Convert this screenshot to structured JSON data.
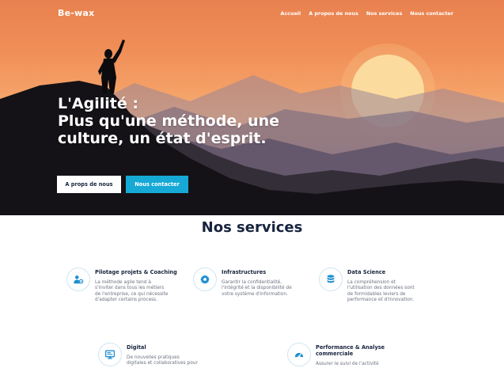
{
  "nav": {
    "brand": "Be-wax",
    "links": [
      "Accueil",
      "A propos de nous",
      "Nos services",
      "Nous contacter"
    ]
  },
  "hero": {
    "title_lines": [
      "L'Agilité :",
      "Plus qu'une méthode, une",
      "culture, un état d'esprit."
    ],
    "buttons": {
      "about": "A props de nous",
      "contact": "Nous contacter"
    }
  },
  "services": {
    "title": "Nos services",
    "items": [
      {
        "icon": "user-cog-icon",
        "title_lines": [
          "Pilotage projets & Coaching"
        ],
        "desc_lines": [
          "La méthode agile tend à",
          "s'inviter dans tous les métiers",
          "de l'entreprise, ce qui nécessite",
          "d'adapter certains process."
        ]
      },
      {
        "icon": "gear-icon",
        "title_lines": [
          "Infrastructures"
        ],
        "desc_lines": [
          "Garantir la confidentialité,",
          "l'intégrité et la disponibilité de",
          "votre système d'information."
        ]
      },
      {
        "icon": "database-icon",
        "title_lines": [
          "Data Science"
        ],
        "desc_lines": [
          "La compréhension et",
          "l'utilisation des données sont",
          "de formidables leviers de",
          "performance et d'innovation."
        ]
      },
      {
        "icon": "monitor-icon",
        "title_lines": [
          "Digital"
        ],
        "desc_lines": [
          "De nouvelles pratiques",
          "digitales et collaboratives pour"
        ]
      },
      {
        "icon": "gauge-icon",
        "title_lines": [
          "Performance & Analyse",
          "commerciale"
        ],
        "desc_lines": [
          "Assurer le suivi de l'activité"
        ]
      }
    ]
  },
  "colors": {
    "accent": "#17a9d6",
    "dark_text": "#17233e",
    "icon_blue": "#1e8fd0"
  }
}
